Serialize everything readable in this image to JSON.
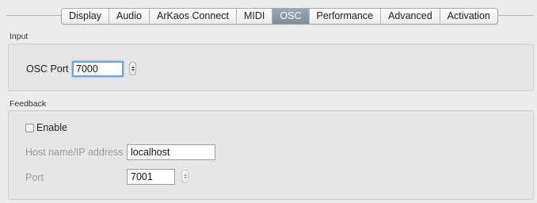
{
  "tabs": [
    {
      "label": "Display",
      "active": false
    },
    {
      "label": "Audio",
      "active": false
    },
    {
      "label": "ArKaos Connect",
      "active": false
    },
    {
      "label": "MIDI",
      "active": false
    },
    {
      "label": "OSC",
      "active": true
    },
    {
      "label": "Performance",
      "active": false
    },
    {
      "label": "Advanced",
      "active": false
    },
    {
      "label": "Activation",
      "active": false
    }
  ],
  "input": {
    "section_label": "Input",
    "osc_port_label": "OSC Port",
    "osc_port_value": "7000"
  },
  "feedback": {
    "section_label": "Feedback",
    "enable_label": "Enable",
    "enable_checked": false,
    "host_label": "Host name/IP address",
    "host_value": "localhost",
    "port_label": "Port",
    "port_value": "7001"
  },
  "colors": {
    "active_tab": "#8a97a7",
    "focus_ring": "#6aa1e3",
    "disabled_text": "#9a9a9a"
  },
  "icons": {
    "stepper": "stepper-arrows-icon",
    "checkbox": "checkbox-unchecked-icon"
  }
}
